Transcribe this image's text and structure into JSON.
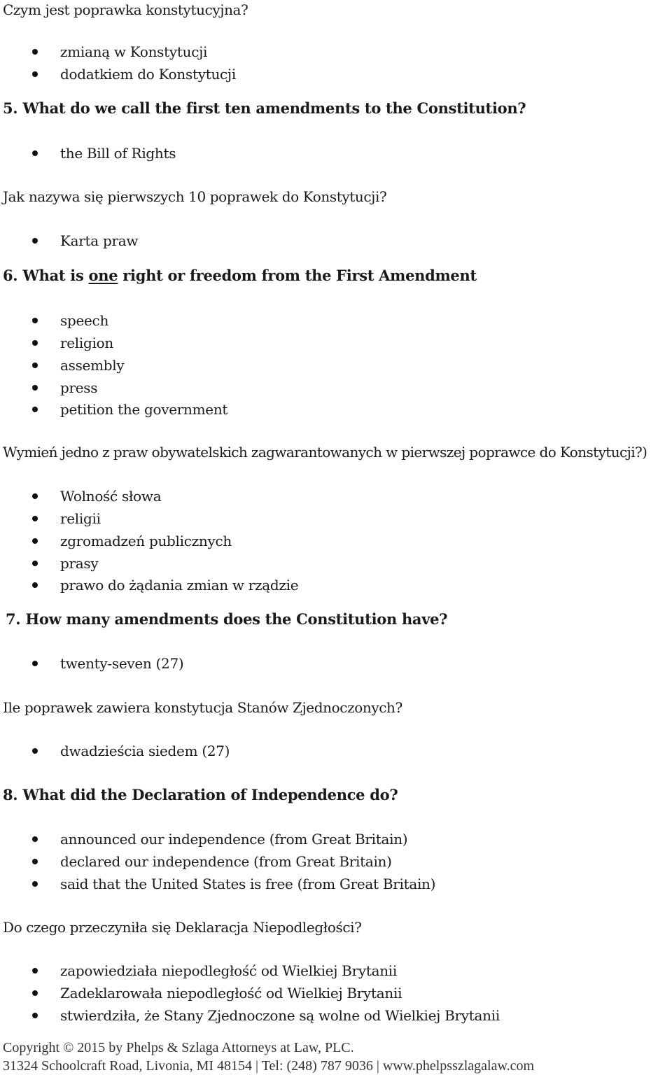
{
  "sections": [
    {
      "pl_question": "Czym jest poprawka konstytucyjna?",
      "pl_answers": [
        "zmianą w Konstytucji",
        "dodatkiem do Konstytucji"
      ]
    },
    {
      "en_question": "5. What do we call the first ten amendments to the Constitution?",
      "en_answers": [
        "the Bill of Rights"
      ],
      "pl_question": "Jak nazywa się pierwszych 10 poprawek do Konstytucji?",
      "pl_answers": [
        "Karta praw"
      ]
    },
    {
      "en_question_prefix": "6. What is ",
      "en_question_emphasis": "one",
      "en_question_suffix": " right or freedom from the First Amendment",
      "en_answers": [
        "speech",
        "religion",
        "assembly",
        "press",
        "petition the government"
      ],
      "pl_question": "Wymień jedno z praw obywatelskich zagwarantowanych w pierwszej poprawce do Konstytucji?)",
      "pl_answers": [
        "Wolność słowa",
        "religii",
        "zgromadzeń publicznych",
        "prasy",
        "prawo do żądania zmian w rządzie"
      ]
    },
    {
      "en_question": "7. How many amendments does the Constitution have?",
      "en_answers": [
        "twenty-seven (27)"
      ],
      "pl_question": "Ile poprawek zawiera konstytucja Stanów Zjednoczonych?",
      "pl_answers": [
        "dwadzieścia siedem (27)"
      ]
    },
    {
      "en_question": "8. What did the Declaration of Independence do?",
      "en_answers": [
        "announced our independence (from Great Britain)",
        "declared our independence (from Great Britain)",
        "said that the United States is free (from Great Britain)"
      ],
      "pl_question": "Do czego przeczyniła się Deklaracja Niepodległości?",
      "pl_answers": [
        "zapowiedziała niepodległość od Wielkiej Brytanii",
        "Zadeklarowała niepodległość od Wielkiej Brytanii",
        "stwierdziła, że Stany Zjednoczone są wolne od Wielkiej Brytanii"
      ]
    }
  ],
  "footer": {
    "copyright": "Copyright © 2015 by Phelps & Szlaga Attorneys at Law, PLC.",
    "address": "31324 Schoolcraft Road, Livonia, MI 48154 | Tel: (248) 787 9036 | www.phelpsszlagalaw.com"
  }
}
